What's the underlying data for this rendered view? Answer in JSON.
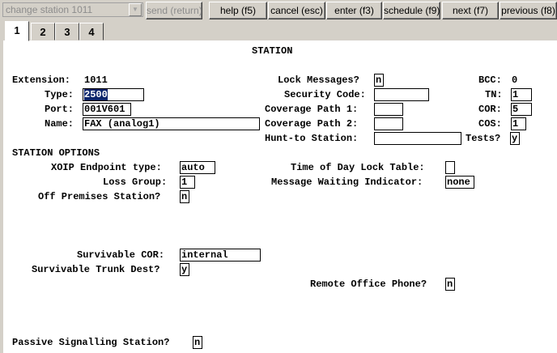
{
  "toolbar": {
    "command_value": "change station 1011",
    "buttons": {
      "send": "send (return)",
      "help": "help (f5)",
      "cancel": "cancel (esc)",
      "enter": "enter (f3)",
      "schedule": "schedule (f9)",
      "next": "next (f7)",
      "previous": "previous (f8)"
    }
  },
  "tabs": [
    "1",
    "2",
    "3",
    "4"
  ],
  "form": {
    "title": "STATION",
    "extension_label": "Extension:",
    "extension_value": "1011",
    "type_label": "Type:",
    "type_value": "2500",
    "port_label": "Port:",
    "port_value": "001V601",
    "name_label": "Name:",
    "name_value": "FAX (analog1)",
    "lock_messages_label": "Lock Messages?",
    "lock_messages_value": "n",
    "security_code_label": "Security Code:",
    "security_code_value": "",
    "coverage_path_1_label": "Coverage Path 1:",
    "coverage_path_1_value": "",
    "coverage_path_2_label": "Coverage Path 2:",
    "coverage_path_2_value": "",
    "hunt_to_station_label": "Hunt-to Station:",
    "hunt_to_station_value": "",
    "bcc_label": "BCC:",
    "bcc_value": "0",
    "tn_label": "TN:",
    "tn_value": "1",
    "cor_label": "COR:",
    "cor_value": "5",
    "cos_label": "COS:",
    "cos_value": "1",
    "tests_label": "Tests?",
    "tests_value": "y",
    "station_options_heading": "STATION OPTIONS",
    "xoip_label": "XOIP Endpoint type:",
    "xoip_value": "auto",
    "loss_group_label": "Loss Group:",
    "loss_group_value": "1",
    "off_premises_label": "Off Premises Station?",
    "off_premises_value": "n",
    "time_of_day_label": "Time of Day Lock Table:",
    "time_of_day_value": "",
    "mwi_label": "Message Waiting Indicator:",
    "mwi_value": "none",
    "survivable_cor_label": "Survivable COR:",
    "survivable_cor_value": "internal",
    "survivable_trunk_label": "Survivable Trunk Dest?",
    "survivable_trunk_value": "y",
    "remote_office_label": "Remote Office Phone?",
    "remote_office_value": "n",
    "passive_signalling_label": "Passive Signalling Station?",
    "passive_signalling_value": "n"
  },
  "colors": {
    "selection": "#0a246a",
    "background": "#d4d0c8",
    "panel": "#ffffff"
  }
}
